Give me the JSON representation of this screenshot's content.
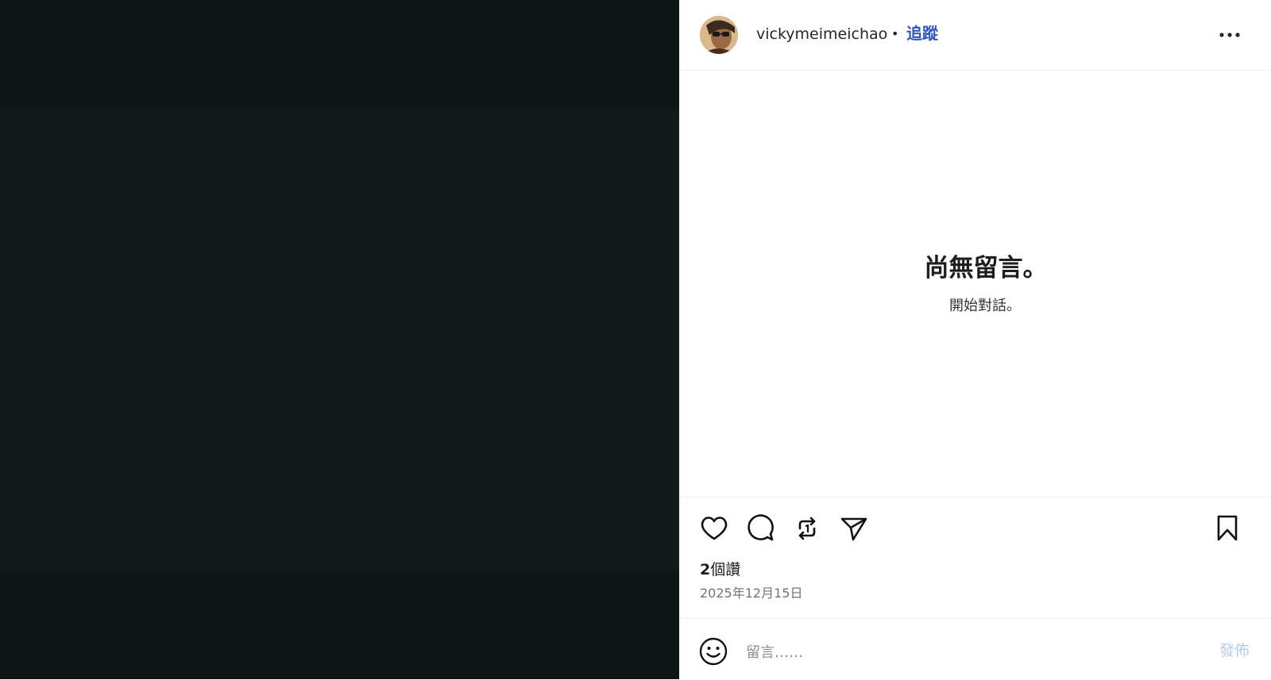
{
  "post": {
    "username": "vickymeimeichao",
    "separator": "•",
    "follow_label": "追蹤",
    "more_icon": "more-horizontal-icon"
  },
  "comments": {
    "empty_title": "尚無留言。",
    "empty_subtitle": "開始對話。"
  },
  "actions": {
    "like_icon": "heart-icon",
    "comment_icon": "comment-icon",
    "repost_icon": "repost-icon",
    "share_icon": "send-icon",
    "save_icon": "bookmark-icon"
  },
  "stats": {
    "likes_count": "2",
    "likes_suffix": "個讚",
    "date": "2025年12月15日"
  },
  "composer": {
    "placeholder": "留言……",
    "post_label": "發佈",
    "emoji_icon": "smiley-icon"
  },
  "colors": {
    "accent": "#2f56b8",
    "post_disabled": "#b6cbe9",
    "viewer_bg": "#101615"
  }
}
